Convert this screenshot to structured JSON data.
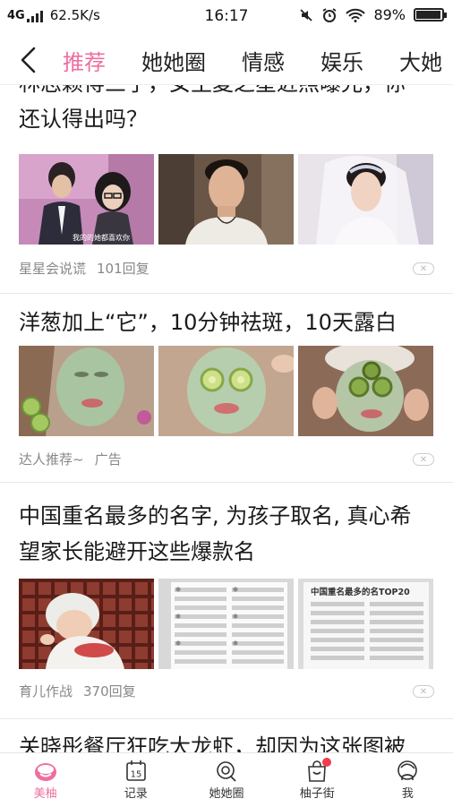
{
  "status_bar": {
    "network": "4G",
    "speed": "62.5K/s",
    "time": "16:17",
    "battery": "89%",
    "battery_level": 0.89
  },
  "top_nav": {
    "tabs": [
      {
        "label": "推荐",
        "active": true
      },
      {
        "label": "她她圈",
        "active": false
      },
      {
        "label": "情感",
        "active": false
      },
      {
        "label": "娱乐",
        "active": false
      },
      {
        "label": "大她",
        "active": false
      }
    ]
  },
  "feed": {
    "articles": [
      {
        "title_line1": "林志颖得三子，女主夏之星近照曝光，你",
        "title_line2": "还认得出吗？",
        "images": [
          "drama-couple-photo",
          "young-man-portrait",
          "bride-portrait"
        ],
        "source": "星星会说谎",
        "replies": "101回复",
        "subtitle_on_image": "我的的她都喜欢你"
      },
      {
        "title_line1": "洋葱加上“它”，10分钟祛斑，10天露白",
        "images": [
          "face-mask-cucumber-1",
          "face-mask-cucumber-2",
          "face-mask-kiwi"
        ],
        "source": "达人推荐~",
        "replies": "广告"
      },
      {
        "title_line1": "中国重名最多的名字, 为孩子取名, 真心希",
        "title_line2": "望家长能避开这些爆款名",
        "images": [
          "sleeping-baby",
          "name-list-table",
          "name-ranking-table"
        ],
        "table_title": "中国重名最多的名TOP20",
        "source": "育儿作战",
        "replies": "370回复"
      },
      {
        "title_line1": "关晓彤餐厅狂吃大龙虾，却因为这张图被"
      }
    ]
  },
  "tab_bar": {
    "items": [
      {
        "label": "美柚",
        "icon": "meiyou-icon",
        "active": true
      },
      {
        "label": "记录",
        "icon": "calendar-icon",
        "date": "15"
      },
      {
        "label": "她她圈",
        "icon": "search-circle-icon"
      },
      {
        "label": "柚子街",
        "icon": "shopping-bag-icon",
        "badge": true
      },
      {
        "label": "我",
        "icon": "profile-icon"
      }
    ]
  },
  "colors": {
    "accent": "#ef6ea0",
    "badge": "#f03b50"
  }
}
